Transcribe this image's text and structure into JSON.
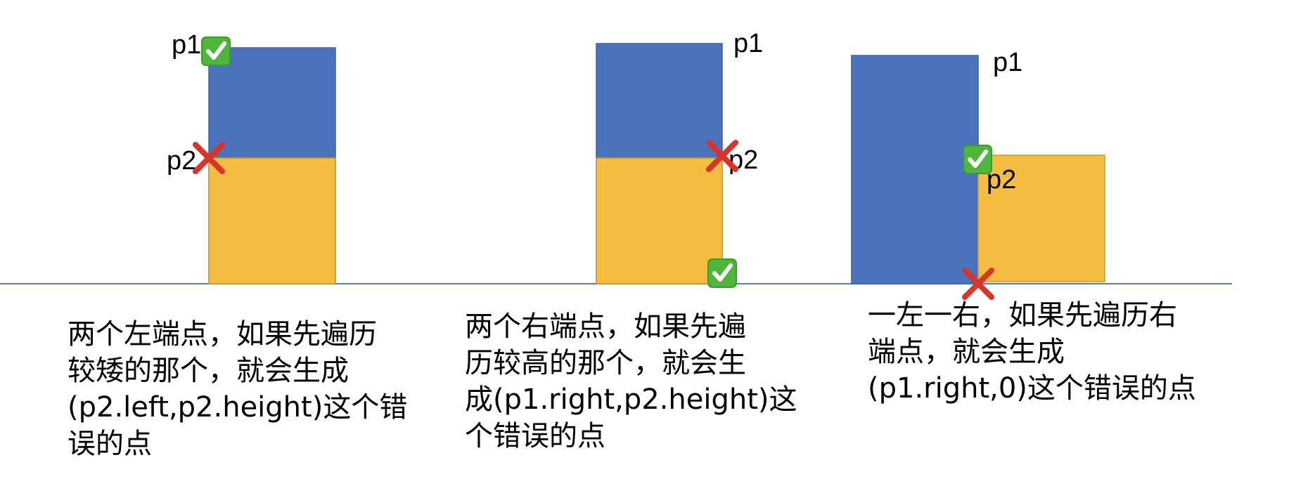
{
  "colors": {
    "tall_bar": "#4a72bd",
    "short_bar": "#f4bd40",
    "baseline": "#5b7bb3",
    "correct_mark": "#3c9b2a",
    "wrong_mark": "#d7352a"
  },
  "panels": [
    {
      "p1_label": "p1",
      "p2_label": "p2",
      "p1_marker": "check-mark-icon",
      "p2_marker": "cross-mark-icon",
      "caption_lines": [
        "两个左端点，如果先遍历",
        "较矮的那个，就会生成",
        "(p2.left,p2.height)这个错",
        "误的点"
      ]
    },
    {
      "p1_label": "p1",
      "p2_label": "p2",
      "p2_marker": "cross-mark-icon",
      "bottom_marker": "check-mark-icon",
      "caption_lines": [
        "两个右端点，如果先遍",
        "历较高的那个，就会生",
        "成(p1.right,p2.height)这",
        "个错误的点"
      ]
    },
    {
      "p1_label": "p1",
      "p2_label": "p2",
      "p2_marker": "check-mark-icon",
      "bottom_marker": "cross-mark-icon",
      "caption_lines": [
        "一左一右，如果先遍历右",
        "端点，就会生成",
        "(p1.right,0)这个错误的点"
      ]
    }
  ]
}
